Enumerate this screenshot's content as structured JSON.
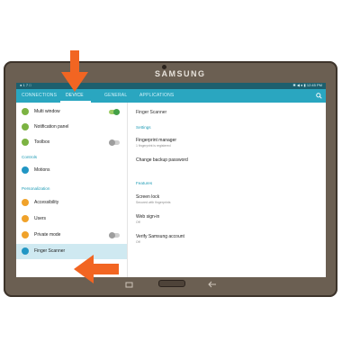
{
  "device": {
    "brand": "SAMSUNG"
  },
  "statusbar": {
    "left": "● 1 7 □",
    "right": "✱ ◀ ● ▮ 12:45 PM"
  },
  "tabs": [
    {
      "label": "CONNECTIONS"
    },
    {
      "label": "DEVICE"
    },
    {
      "label": "GENERAL"
    },
    {
      "label": "APPLICATIONS"
    }
  ],
  "left_panel": {
    "items_top": [
      {
        "label": "Multi window",
        "icon_color": "#7cb342",
        "toggle": "on"
      },
      {
        "label": "Notification panel",
        "icon_color": "#7cb342",
        "toggle": "none"
      },
      {
        "label": "Toolbox",
        "icon_color": "#7cb342",
        "toggle": "off"
      }
    ],
    "section_controls": "Controls",
    "items_controls": [
      {
        "label": "Motions",
        "icon_color": "#2196c4",
        "toggle": "none"
      }
    ],
    "section_personalization": "Personalization",
    "items_personalization": [
      {
        "label": "Accessibility",
        "icon_color": "#f0a22a",
        "toggle": "none"
      },
      {
        "label": "Users",
        "icon_color": "#f0a22a",
        "toggle": "none"
      },
      {
        "label": "Private mode",
        "icon_color": "#f0a22a",
        "toggle": "off"
      },
      {
        "label": "Finger Scanner",
        "icon_color": "#2196c4",
        "toggle": "none",
        "selected": true
      }
    ]
  },
  "right_panel": {
    "header": "Finger Scanner",
    "section_settings": "Settings",
    "fingerprint_manager": {
      "title": "Fingerprint manager",
      "subtitle": "1 fingerprint is registered"
    },
    "change_backup": {
      "title": "Change backup password"
    },
    "section_features": "Features",
    "screen_lock": {
      "title": "Screen lock",
      "subtitle": "Secured with fingerprints"
    },
    "web_signin": {
      "title": "Web sign-in",
      "subtitle": "Off"
    },
    "verify_account": {
      "title": "Verify Samsung account",
      "subtitle": "Off"
    }
  },
  "colors": {
    "accent": "#2aa6c0",
    "arrow": "#f26522",
    "selected_bg": "#cfe9f1"
  }
}
